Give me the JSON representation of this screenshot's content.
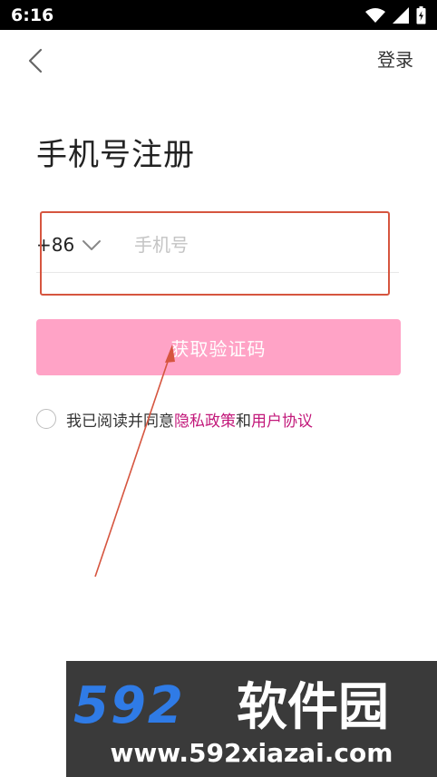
{
  "status_bar": {
    "time": "6:16",
    "icons": [
      "wifi-icon",
      "signal-icon",
      "battery-icon"
    ]
  },
  "header": {
    "back_icon": "chevron-left-icon",
    "login_label": "登录"
  },
  "page": {
    "title": "手机号注册"
  },
  "phone_form": {
    "country_code": "+86",
    "country_chevron_icon": "chevron-down-icon",
    "phone_value": "",
    "phone_placeholder": "手机号"
  },
  "get_code_button": {
    "label": "获取验证码",
    "color": "#ffa3c6"
  },
  "agreement": {
    "prefix": "我已阅读并同意",
    "privacy_link": "隐私政策",
    "connector": "和",
    "terms_link": "用户协议",
    "link_color": "#c2187a"
  },
  "annotation": {
    "color": "#d6553f"
  },
  "watermark": {
    "brand": "592软件园",
    "url": "www.592xiazai.com"
  }
}
